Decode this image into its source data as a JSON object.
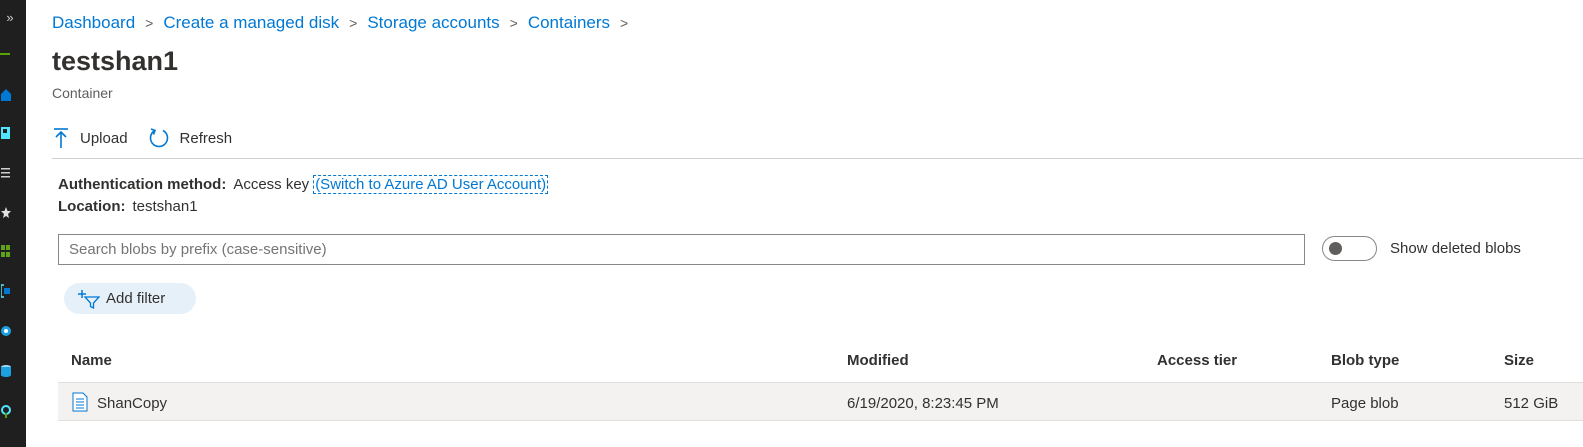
{
  "breadcrumb": {
    "items": [
      "Dashboard",
      "Create a managed disk",
      "Storage accounts",
      "Containers"
    ]
  },
  "page": {
    "title": "testshan1",
    "subtitle": "Container"
  },
  "toolbar": {
    "upload_label": "Upload",
    "refresh_label": "Refresh"
  },
  "auth": {
    "label": "Authentication method:",
    "value": "Access key",
    "switch_link": "(Switch to Azure AD User Account)"
  },
  "location": {
    "label": "Location:",
    "value": "testshan1"
  },
  "search": {
    "placeholder": "Search blobs by prefix (case-sensitive)",
    "value": ""
  },
  "show_deleted": {
    "label": "Show deleted blobs",
    "on": false
  },
  "filter": {
    "add_label": "Add filter"
  },
  "table": {
    "columns": [
      "Name",
      "Modified",
      "Access tier",
      "Blob type",
      "Size"
    ],
    "rows": [
      {
        "name": "ShanCopy",
        "modified": "6/19/2020, 8:23:45 PM",
        "access_tier": "",
        "blob_type": "Page blob",
        "size": "512 GiB"
      }
    ]
  },
  "colors": {
    "accent": "#0078d4",
    "rail": "#1f1f1f",
    "row_bg": "#f3f2f1",
    "filter_bg": "#e6f0f9"
  }
}
